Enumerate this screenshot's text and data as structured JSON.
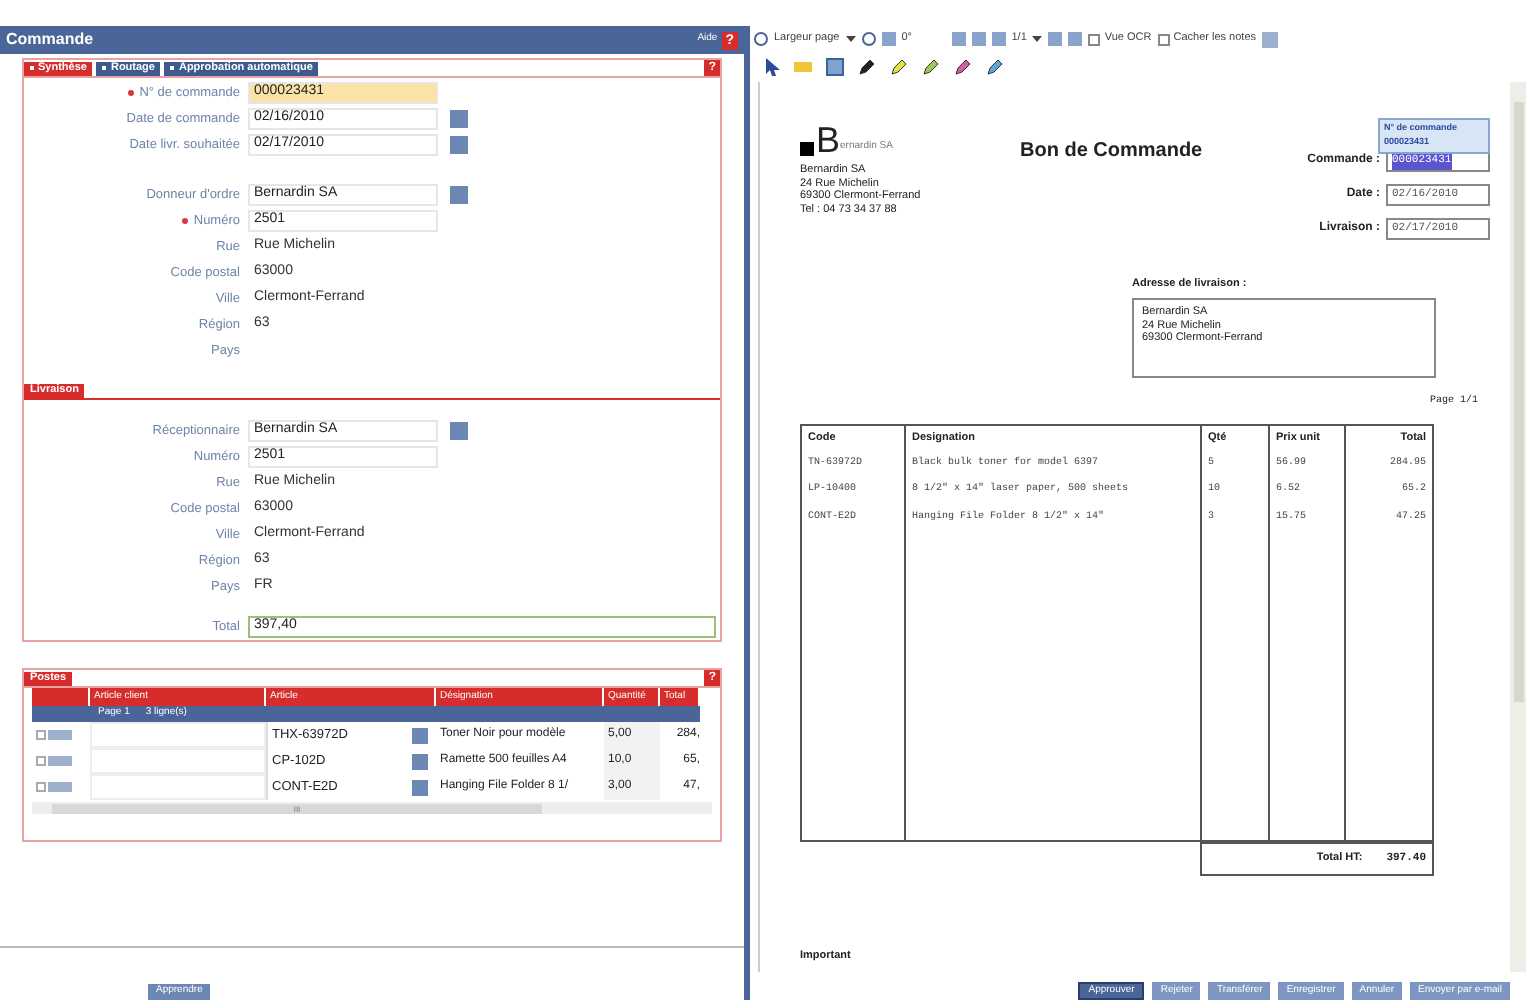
{
  "order_panel": {
    "title": "Commande",
    "help_label": "Aide",
    "help_icon": "?",
    "tabs": [
      {
        "label": "Synthèse",
        "selected": true
      },
      {
        "label": "Routage",
        "selected": false
      },
      {
        "label": "Approbation automatique",
        "selected": false
      }
    ],
    "section_help_icon": "?",
    "fields": [
      {
        "label": "N° de commande",
        "value": "000023431",
        "kind": "input",
        "required": true,
        "highlighted": true,
        "picker": false
      },
      {
        "label": "Date de commande",
        "value": "02/16/2010",
        "kind": "input",
        "required": false,
        "highlighted": false,
        "picker": true
      },
      {
        "label": "Date livr. souhaitée",
        "value": "02/17/2010",
        "kind": "input",
        "required": false,
        "highlighted": false,
        "picker": true
      },
      {
        "kind": "spacer"
      },
      {
        "label": "Donneur d'ordre",
        "value": "Bernardin SA",
        "kind": "input",
        "required": false,
        "highlighted": false,
        "picker": true
      },
      {
        "label": "Numéro",
        "value": "2501",
        "kind": "input",
        "required": true,
        "highlighted": false,
        "picker": false
      },
      {
        "label": "Rue",
        "value": "Rue Michelin",
        "kind": "text"
      },
      {
        "label": "Code postal",
        "value": "63000",
        "kind": "text"
      },
      {
        "label": "Ville",
        "value": "Clermont-Ferrand",
        "kind": "text"
      },
      {
        "label": "Région",
        "value": "63",
        "kind": "text"
      },
      {
        "label": "Pays",
        "kind": "text"
      }
    ],
    "delivery": {
      "title": "Livraison",
      "fields": [
        {
          "label": "Réceptionnaire",
          "value": "Bernardin SA",
          "kind": "input",
          "required": false,
          "highlighted": false,
          "picker": true
        },
        {
          "label": "Numéro",
          "value": "2501",
          "kind": "input",
          "required": false,
          "highlighted": false,
          "picker": false
        },
        {
          "label": "Rue",
          "value": "Rue Michelin",
          "kind": "text"
        },
        {
          "label": "Code postal",
          "value": "63000",
          "kind": "text"
        },
        {
          "label": "Ville",
          "value": "Clermont-Ferrand",
          "kind": "text"
        },
        {
          "label": "Région",
          "value": "63",
          "kind": "text"
        },
        {
          "label": "Pays",
          "value": "FR",
          "kind": "text"
        }
      ],
      "total": {
        "label": "Total",
        "value": "397,40"
      }
    },
    "lines": {
      "title": "Postes",
      "help_icon": "?",
      "columns": [
        "Article client",
        "Article",
        "Désignation",
        "Quantité",
        "Total"
      ],
      "group": {
        "page": "Page 1",
        "count": "3 ligne(s)"
      },
      "rows": [
        {
          "article": "THX-63972D",
          "designation": "Toner Noir pour modèle",
          "quantity": "5,00",
          "total": "284,",
          "checked": false
        },
        {
          "article": "CP-102D",
          "designation": "Ramette 500 feuilles A4",
          "quantity": "10,0",
          "total": "65,",
          "checked": false
        },
        {
          "article": "CONT-E2D",
          "designation": "Hanging File Folder 8 1/",
          "quantity": "3,00",
          "total": "47,",
          "checked": false
        }
      ],
      "scroll_grip": "III"
    },
    "learn_button": "Apprendre"
  },
  "viewer": {
    "toolbar": {
      "zoom_mode": "Largeur page",
      "rotation": "0°",
      "page": "1/1",
      "checkboxes": [
        {
          "label": "Vue OCR",
          "checked": false
        },
        {
          "label": "Cacher les notes",
          "checked": false
        }
      ]
    },
    "document": {
      "logo_letter": "B",
      "logo_text": "ernardin SA",
      "title": "Bon de Commande",
      "sender": [
        "Bernardin SA",
        "24 Rue Michelin",
        "69300 Clermont-Ferrand",
        "Tel : 04 73 34 37 88"
      ],
      "tooltip": {
        "label": "N° de commande",
        "value": "000023431"
      },
      "header_fields": [
        {
          "label": "Commande :",
          "value": "000023431",
          "highlighted": true
        },
        {
          "label": "Date :",
          "value": "02/16/2010",
          "highlighted": false
        },
        {
          "label": "Livraison :",
          "value": "02/17/2010",
          "highlighted": false
        }
      ],
      "delivery_label": "Adresse de livraison :",
      "delivery_lines": [
        "Bernardin SA",
        "24 Rue Michelin",
        "69300 Clermont-Ferrand"
      ],
      "page_label": "Page 1/1",
      "columns": [
        "Code",
        "Designation",
        "Qté",
        "Prix unit",
        "Total"
      ],
      "rows": [
        [
          "TN-63972D",
          "Black bulk toner for model 6397",
          "5",
          "56.99",
          "284.95"
        ],
        [
          "LP-10400",
          "8 1/2\" x 14\" laser paper, 500 sheets",
          "10",
          "6.52",
          "65.2"
        ],
        [
          "CONT-E2D",
          "Hanging File Folder 8 1/2\" x 14\"",
          "3",
          "15.75",
          "47.25"
        ]
      ],
      "total_label": "Total HT:",
      "total_value": "397.40",
      "footer_label": "Important"
    },
    "buttons": [
      {
        "label": "Approuver",
        "primary": true
      },
      {
        "label": "Rejeter",
        "primary": false
      },
      {
        "label": "Transférer",
        "primary": false
      },
      {
        "label": "Enregistrer",
        "primary": false
      },
      {
        "label": "Annuler",
        "primary": false
      },
      {
        "label": "Envoyer par e-mail",
        "primary": false
      }
    ]
  }
}
